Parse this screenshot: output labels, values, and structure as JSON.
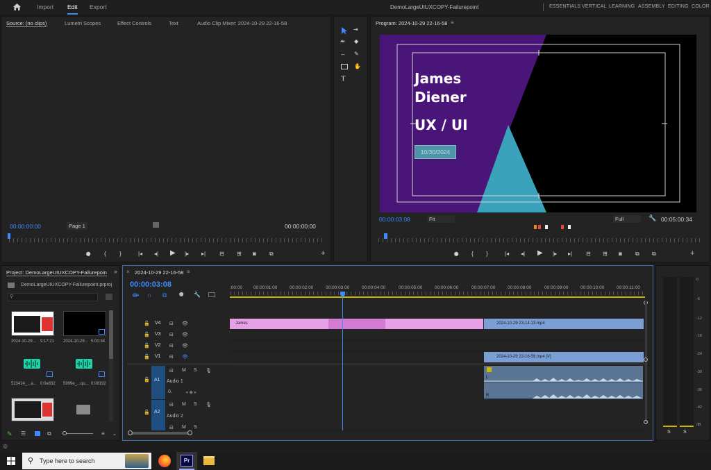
{
  "topbar": {
    "tabs": [
      "Import",
      "Edit",
      "Export"
    ],
    "active_tab": "Edit",
    "project_title": "DemoLargeUIUXCOPY-Failurepoint",
    "workspaces": [
      "ESSENTIALS",
      "VERTICAL",
      "LEARNING",
      "ASSEMBLY",
      "EDITING",
      "COLOR"
    ]
  },
  "source_panel": {
    "tabs": [
      "Source: (no clips)",
      "Lumetri Scopes",
      "Effect Controls",
      "Text",
      "Audio Clip Mixer: 2024-10-29 22-16-58"
    ],
    "timecode_left": "00:00:00:00",
    "page": "Page 1",
    "timecode_right": "00:00:00:00"
  },
  "program_panel": {
    "title": "Program: 2024-10-29 22-16-58",
    "timecode": "00:00:03:08",
    "fit": "Fit",
    "resolution": "Full",
    "duration": "00:05:00:34",
    "graphic": {
      "name_line1": "James",
      "name_line2": "Diener",
      "role": "UX / UI",
      "date": "10/30/2024"
    }
  },
  "tools_panel": {
    "tools": [
      "selection-tool",
      "track-select-tool",
      "ripple-edit-tool",
      "razor-tool",
      "slip-tool",
      "pen-tool",
      "rectangle-tool",
      "hand-tool",
      "type-tool"
    ]
  },
  "project_panel": {
    "title": "Project: DemoLargeUIUXCOPY-Failurepoin",
    "file": "DemoLargeUIUXCOPY-Failurepoint.prproj",
    "items": [
      {
        "name": "2024-10-29...",
        "dur": "9:17:21",
        "kind": "video"
      },
      {
        "name": "2024-10-29...",
        "dur": "5:00:34",
        "kind": "black"
      },
      {
        "name": "523424_...a...",
        "dur": "0:0e832",
        "kind": "audio"
      },
      {
        "name": "5999e_...qu...",
        "dur": "0:08192",
        "kind": "audio"
      },
      {
        "name": "",
        "dur": "",
        "kind": "video"
      },
      {
        "name": "",
        "dur": "",
        "kind": "folder"
      }
    ]
  },
  "timeline": {
    "sequence": "2024-10-29 22-16-58",
    "timecode": "00:00:03:08",
    "ruler_labels": [
      ":00:00",
      "00:00:01:00",
      "00:00:02:00",
      "00:00:03:00",
      "00:00:04:00",
      "00:00:05:00",
      "00:00:06:00",
      "00:00:07:00",
      "00:00:08:00",
      "00:00:09:00",
      "00:00:10:00",
      "00:00:11:00"
    ],
    "video_tracks": [
      "V4",
      "V3",
      "V2",
      "V1"
    ],
    "audio_tracks": [
      {
        "id": "A1",
        "name": "Audio 1"
      },
      {
        "id": "A2",
        "name": "Audio 2"
      }
    ],
    "clips": {
      "v4_graphic": "James",
      "v4_video": "2024-10-29 23-14-23.mp4",
      "v1_video": "2024-10-29 22-16-58.mp4 [V]"
    }
  },
  "meter": {
    "scale": [
      "0",
      "-6",
      "-12",
      "-18",
      "-24",
      "-30",
      "-36",
      "-42",
      "dB"
    ],
    "solo": [
      "S",
      "S"
    ]
  },
  "taskbar": {
    "search_placeholder": "Type here to search",
    "apps": [
      "firefox",
      "premiere",
      "file-explorer"
    ],
    "premiere_label": "Pr"
  },
  "colors": {
    "accent": "#3d8bff",
    "graphic_purple": "#4a1578",
    "graphic_teal": "#3aa3bb",
    "clip_pink": "#e6a0e6",
    "clip_blue": "#7b9fd4",
    "audio_teal": "#1bd3a6"
  }
}
